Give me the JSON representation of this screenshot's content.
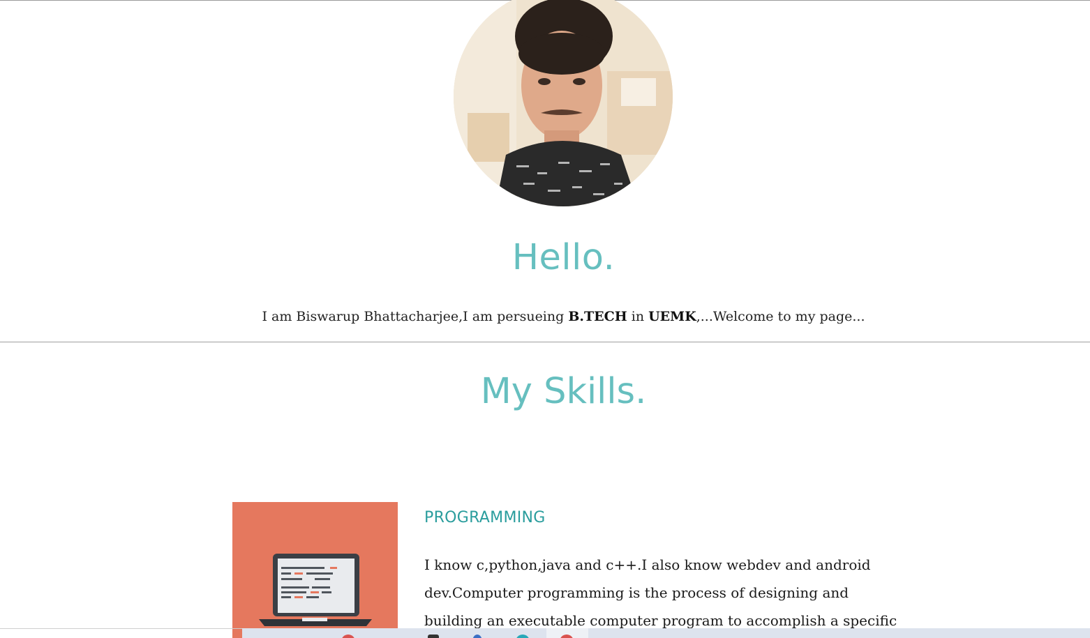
{
  "profile": {
    "photo_alt": "profile-photo"
  },
  "hero": {
    "greeting": "Hello.",
    "intro_part1": "I am Biswarup Bhattacharjee,I am persueing ",
    "intro_bold1": "B.TECH",
    "intro_part2": " in ",
    "intro_bold2": "UEMK",
    "intro_part3": ",...Welcome to my page..."
  },
  "skills": {
    "title": "My Skills.",
    "items": [
      {
        "heading": "PROGRAMMING",
        "icon": "laptop-code-icon",
        "description": "I know c,python,java and c++.I also know webdev and android dev.Computer programming is the process of designing and building an executable computer program to accomplish a specific"
      }
    ]
  },
  "colors": {
    "accent": "#66bfbf",
    "heading_teal": "#2a9d9d",
    "skill_tile_bg": "#e5785e",
    "taskbar_bg": "#dde3ee"
  },
  "taskbar": {
    "icons": [
      "red-app-icon",
      "dark-app-icon",
      "blue-app-icon",
      "teal-app-icon",
      "red-app-icon"
    ]
  }
}
